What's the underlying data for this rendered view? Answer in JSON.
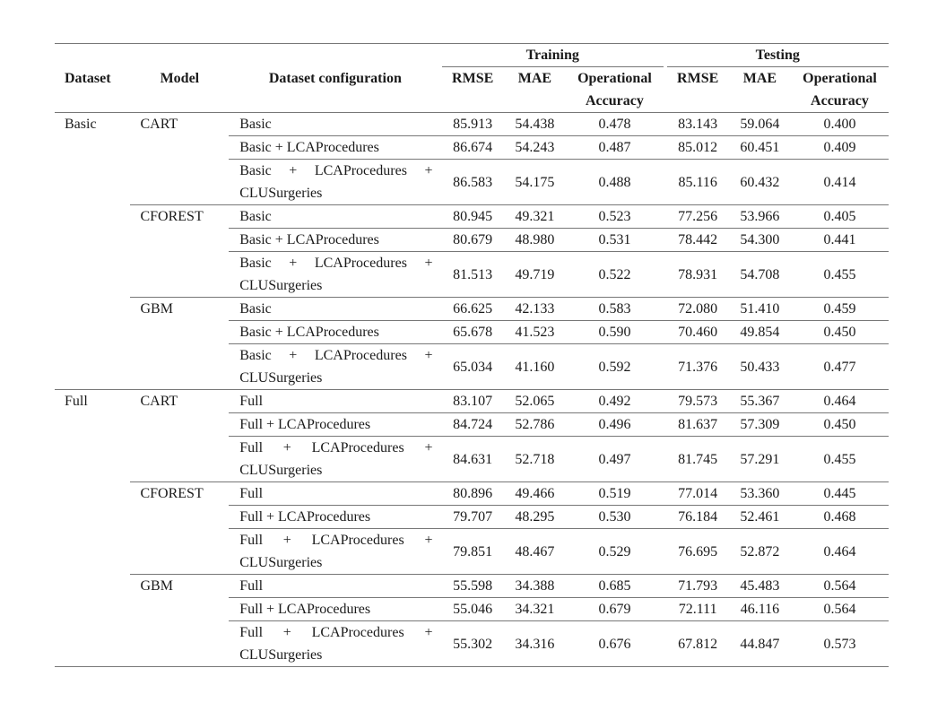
{
  "table": {
    "headers": {
      "dataset": "Dataset",
      "model": "Model",
      "config": "Dataset configuration",
      "training": "Training",
      "testing": "Testing",
      "rmse": "RMSE",
      "mae": "MAE",
      "opacc_line1": "Operational",
      "opacc_line2": "Accuracy"
    },
    "groups": [
      {
        "dataset": "Basic",
        "models": [
          {
            "model": "CART",
            "rows": [
              {
                "config": "Basic",
                "config_l1": "",
                "config_l2": "",
                "train_rmse": "85.913",
                "train_mae": "54.438",
                "train_oa": "0.478",
                "test_rmse": "83.143",
                "test_mae": "59.064",
                "test_oa": "0.400"
              },
              {
                "config": "Basic + LCAProcedures",
                "train_rmse": "86.674",
                "train_mae": "54.243",
                "train_oa": "0.487",
                "test_rmse": "85.012",
                "test_mae": "60.451",
                "test_oa": "0.409"
              },
              {
                "config_parts": [
                  "Basic",
                  "+",
                  "LCAProcedures",
                  "+"
                ],
                "config_l2": "CLUSurgeries",
                "train_rmse": "86.583",
                "train_mae": "54.175",
                "train_oa": "0.488",
                "test_rmse": "85.116",
                "test_mae": "60.432",
                "test_oa": "0.414"
              }
            ]
          },
          {
            "model": "CFOREST",
            "rows": [
              {
                "config": "Basic",
                "train_rmse": "80.945",
                "train_mae": "49.321",
                "train_oa": "0.523",
                "test_rmse": "77.256",
                "test_mae": "53.966",
                "test_oa": "0.405"
              },
              {
                "config": "Basic + LCAProcedures",
                "train_rmse": "80.679",
                "train_mae": "48.980",
                "train_oa": "0.531",
                "test_rmse": "78.442",
                "test_mae": "54.300",
                "test_oa": "0.441"
              },
              {
                "config_parts": [
                  "Basic",
                  "+",
                  "LCAProcedures",
                  "+"
                ],
                "config_l2": "CLUSurgeries",
                "train_rmse": "81.513",
                "train_mae": "49.719",
                "train_oa": "0.522",
                "test_rmse": "78.931",
                "test_mae": "54.708",
                "test_oa": "0.455"
              }
            ]
          },
          {
            "model": "GBM",
            "rows": [
              {
                "config": "Basic",
                "train_rmse": "66.625",
                "train_mae": "42.133",
                "train_oa": "0.583",
                "test_rmse": "72.080",
                "test_mae": "51.410",
                "test_oa": "0.459"
              },
              {
                "config": "Basic + LCAProcedures",
                "train_rmse": "65.678",
                "train_mae": "41.523",
                "train_oa": "0.590",
                "test_rmse": "70.460",
                "test_mae": "49.854",
                "test_oa": "0.450"
              },
              {
                "config_parts": [
                  "Basic",
                  "+",
                  "LCAProcedures",
                  "+"
                ],
                "config_l2": "CLUSurgeries",
                "train_rmse": "65.034",
                "train_mae": "41.160",
                "train_oa": "0.592",
                "test_rmse": "71.376",
                "test_mae": "50.433",
                "test_oa": "0.477"
              }
            ]
          }
        ]
      },
      {
        "dataset": "Full",
        "models": [
          {
            "model": "CART",
            "rows": [
              {
                "config": "Full",
                "train_rmse": "83.107",
                "train_mae": "52.065",
                "train_oa": "0.492",
                "test_rmse": "79.573",
                "test_mae": "55.367",
                "test_oa": "0.464"
              },
              {
                "config": "Full + LCAProcedures",
                "train_rmse": "84.724",
                "train_mae": "52.786",
                "train_oa": "0.496",
                "test_rmse": "81.637",
                "test_mae": "57.309",
                "test_oa": "0.450"
              },
              {
                "config_parts": [
                  "Full",
                  "+",
                  "LCAProcedures",
                  "+"
                ],
                "config_l2": "CLUSurgeries",
                "train_rmse": "84.631",
                "train_mae": "52.718",
                "train_oa": "0.497",
                "test_rmse": "81.745",
                "test_mae": "57.291",
                "test_oa": "0.455"
              }
            ]
          },
          {
            "model": "CFOREST",
            "rows": [
              {
                "config": "Full",
                "train_rmse": "80.896",
                "train_mae": "49.466",
                "train_oa": "0.519",
                "test_rmse": "77.014",
                "test_mae": "53.360",
                "test_oa": "0.445"
              },
              {
                "config": "Full + LCAProcedures",
                "train_rmse": "79.707",
                "train_mae": "48.295",
                "train_oa": "0.530",
                "test_rmse": "76.184",
                "test_mae": "52.461",
                "test_oa": "0.468"
              },
              {
                "config_parts": [
                  "Full",
                  "+",
                  "LCAProcedures",
                  "+"
                ],
                "config_l2": "CLUSurgeries",
                "train_rmse": "79.851",
                "train_mae": "48.467",
                "train_oa": "0.529",
                "test_rmse": "76.695",
                "test_mae": "52.872",
                "test_oa": "0.464"
              }
            ]
          },
          {
            "model": "GBM",
            "rows": [
              {
                "config": "Full",
                "train_rmse": "55.598",
                "train_mae": "34.388",
                "train_oa": "0.685",
                "test_rmse": "71.793",
                "test_mae": "45.483",
                "test_oa": "0.564"
              },
              {
                "config": "Full + LCAProcedures",
                "train_rmse": "55.046",
                "train_mae": "34.321",
                "train_oa": "0.679",
                "test_rmse": "72.111",
                "test_mae": "46.116",
                "test_oa": "0.564"
              },
              {
                "config_parts": [
                  "Full",
                  "+",
                  "LCAProcedures",
                  "+"
                ],
                "config_l2": "CLUSurgeries",
                "train_rmse": "55.302",
                "train_mae": "34.316",
                "train_oa": "0.676",
                "test_rmse": "67.812",
                "test_mae": "44.847",
                "test_oa": "0.573"
              }
            ]
          }
        ]
      }
    ]
  }
}
